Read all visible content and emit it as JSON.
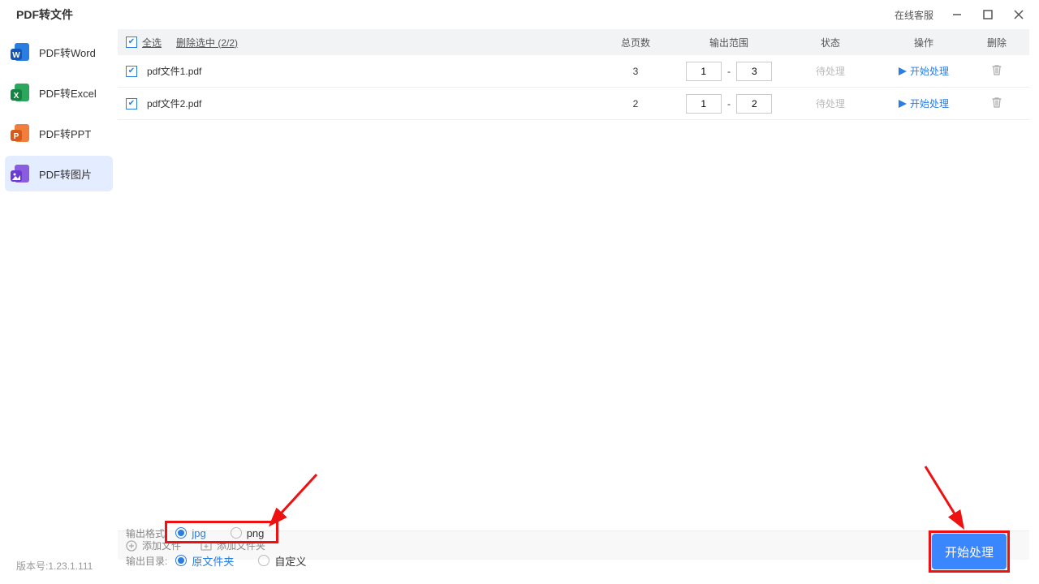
{
  "title": "PDF转文件",
  "customer_service": "在线客服",
  "sidebar": [
    {
      "label": "PDF转Word"
    },
    {
      "label": "PDF转Excel"
    },
    {
      "label": "PDF转PPT"
    },
    {
      "label": "PDF转图片"
    }
  ],
  "headers": {
    "select_all": "全选",
    "delete_selected": "删除选中 (2/2)",
    "total_pages": "总页数",
    "range": "输出范围",
    "status": "状态",
    "action": "操作",
    "delete": "删除"
  },
  "rows": [
    {
      "name": "pdf文件1.pdf",
      "pages": "3",
      "from": "1",
      "to": "3",
      "status": "待处理",
      "action": "开始处理"
    },
    {
      "name": "pdf文件2.pdf",
      "pages": "2",
      "from": "1",
      "to": "2",
      "status": "待处理",
      "action": "开始处理"
    }
  ],
  "add_file": "添加文件",
  "add_folder": "添加文件夹",
  "fmt_label": "输出格式:",
  "fmt_jpg": "jpg",
  "fmt_png": "png",
  "dir_label": "输出目录:",
  "dir_src": "原文件夹",
  "dir_custom": "自定义",
  "start": "开始处理",
  "version": "版本号:1.23.1.111"
}
